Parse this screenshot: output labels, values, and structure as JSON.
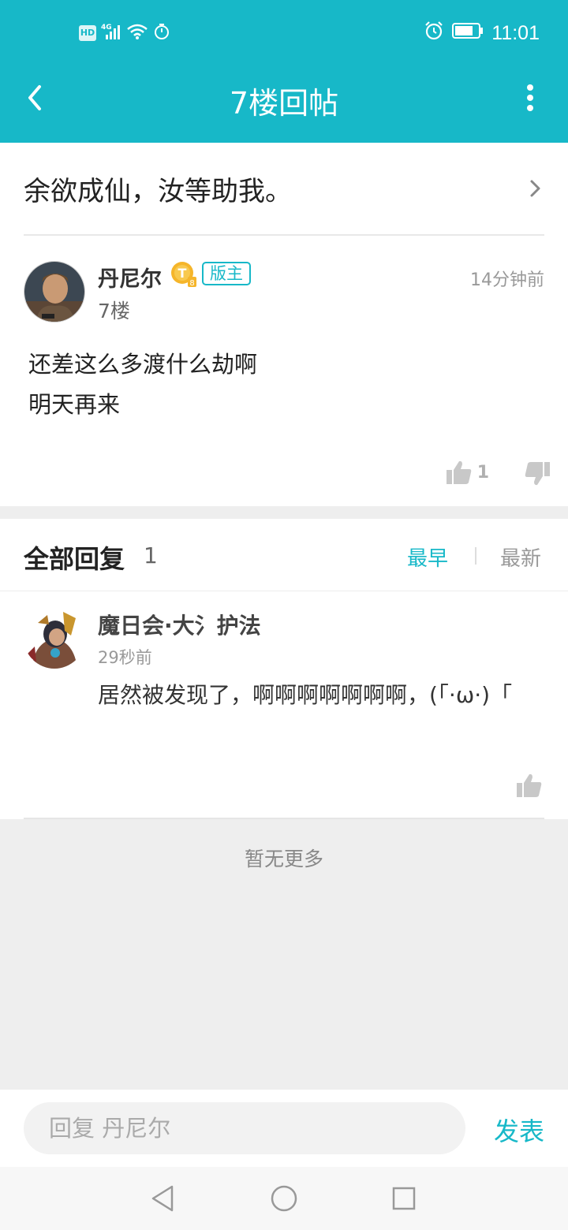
{
  "status_bar": {
    "left_icons": [
      "hd-badge",
      "4g-signal-icon",
      "wifi-icon",
      "timer-icon"
    ],
    "hd_label": "HD",
    "right_icons": [
      "alarm-icon",
      "battery-icon"
    ],
    "time": "11:01"
  },
  "header": {
    "title": "7楼回帖",
    "back_icon": "back-chevron-icon",
    "more_icon": "more-vertical-icon"
  },
  "thread": {
    "title": "余欲成仙，汝等助我。"
  },
  "post": {
    "author": "丹尼尔",
    "level_badge": "T",
    "level_number": "8",
    "role": "版主",
    "floor": "7楼",
    "time": "14分钟前",
    "content_lines": [
      "还差这么多渡什么劫啊",
      "明天再来"
    ],
    "like_count": "1"
  },
  "replies": {
    "title": "全部回复",
    "count": "1",
    "sort_earliest": "最早",
    "sort_latest": "最新",
    "items": [
      {
        "name": "魔日会·大氵护法",
        "time": "29秒前",
        "text": "居然被发现了，啊啊啊啊啊啊啊，(「·ω·)「"
      }
    ]
  },
  "footer_note": "暂无更多",
  "reply_bar": {
    "placeholder": "回复 丹尼尔",
    "send_label": "发表"
  },
  "colors": {
    "accent": "#17b8c8",
    "page_bg": "#eeeeee"
  }
}
